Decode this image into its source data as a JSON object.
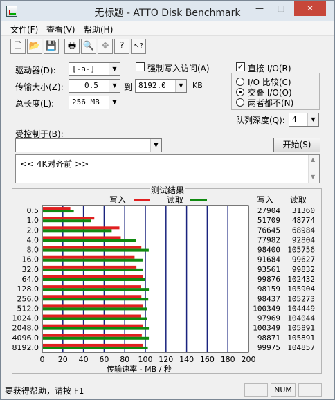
{
  "window": {
    "title": "无标题 - ATTO Disk Benchmark"
  },
  "window_controls": {
    "minimize": "—",
    "maximize": "□",
    "close": "✕"
  },
  "menu": [
    "文件(F)",
    "查看(V)",
    "帮助(H)"
  ],
  "toolbar": {
    "buttons": [
      {
        "name": "new-icon",
        "glyph": "🗋"
      },
      {
        "name": "open-folder-icon",
        "glyph": "📂"
      },
      {
        "name": "save-icon",
        "glyph": "💾"
      },
      {
        "name": "print-icon",
        "glyph": "🖶"
      },
      {
        "name": "print-preview-icon",
        "glyph": "🔍"
      },
      {
        "name": "move-icon",
        "glyph": "✥"
      },
      {
        "name": "help-icon",
        "glyph": "?"
      },
      {
        "name": "context-help-icon",
        "glyph": "↖?"
      }
    ]
  },
  "settings": {
    "drive_label": "驱动器(D):",
    "drive_value": "[-a-]",
    "transfer_label": "传输大小(Z):",
    "transfer_from": "0.5",
    "to_label": "到",
    "transfer_to": "8192.0",
    "kb_label": "KB",
    "length_label": "总长度(L):",
    "length_value": "256 MB",
    "force_write_label": "强制写入访问(A)",
    "direct_io_label": "直接 I/O(R)",
    "io_compare_label": "I/O 比较(C)",
    "overlapped_io_label": "交叠 I/O(O)",
    "neither_label": "两者都不(N)",
    "queue_label": "队列深度(Q):",
    "queue_value": "4",
    "controlled_by_label": "受控制于(B):",
    "controlled_by_value": "",
    "start_button": "开始(S)",
    "notes_text": "<<   4K对齐前    >>"
  },
  "results": {
    "group_title": "测试结果",
    "legend_write": "写入",
    "legend_read": "读取",
    "col_write": "写入",
    "col_read": "读取",
    "xlabel": "传输速率 - MB / 秒"
  },
  "colors": {
    "write": "#e02020",
    "read": "#108a10"
  },
  "chart_data": {
    "type": "bar",
    "orientation": "horizontal",
    "categories": [
      "0.5",
      "1.0",
      "2.0",
      "4.0",
      "8.0",
      "16.0",
      "32.0",
      "64.0",
      "128.0",
      "256.0",
      "512.0",
      "1024.0",
      "2048.0",
      "4096.0",
      "8192.0"
    ],
    "series": [
      {
        "name": "写入",
        "values": [
          27904,
          51709,
          76645,
          77982,
          98400,
          91684,
          93561,
          99876,
          98159,
          98437,
          100349,
          97969,
          100349,
          98871,
          99975
        ]
      },
      {
        "name": "读取",
        "values": [
          31360,
          48774,
          68984,
          92804,
          105756,
          99627,
          99832,
          102432,
          105904,
          105273,
          104449,
          104044,
          105891,
          105891,
          104857
        ]
      }
    ],
    "xticks": [
      "0",
      "20",
      "40",
      "60",
      "80",
      "100",
      "120",
      "140",
      "160",
      "180",
      "200"
    ],
    "xlim": [
      0,
      200
    ],
    "xlabel": "传输速率 - MB / 秒"
  },
  "status": {
    "help_text": "要获得帮助，请按 F1",
    "num": "NUM"
  }
}
